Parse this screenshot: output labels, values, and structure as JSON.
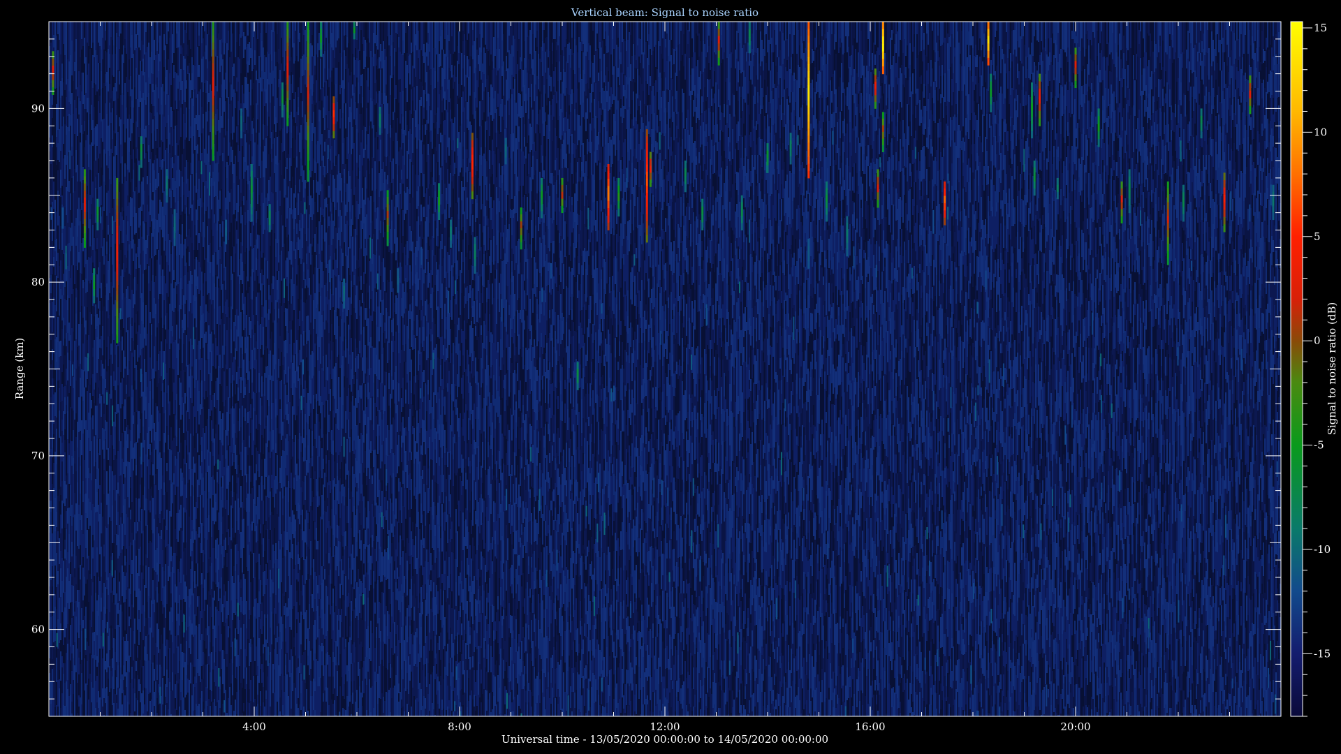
{
  "chart_data": {
    "type": "heatmap",
    "title": "Vertical beam: Signal to noise ratio",
    "xlabel": "Universal time - 13/05/2020 00:00:00 to 14/05/2020 00:00:00",
    "ylabel": "Range (km)",
    "colorbar_label": "Signal to noise ratio (dB)",
    "xlim": [
      0,
      24
    ],
    "ylim": [
      55,
      95
    ],
    "clim": [
      -18,
      15.3
    ],
    "x_ticks": [
      {
        "value": 4,
        "label": "4:00"
      },
      {
        "value": 8,
        "label": "8:00"
      },
      {
        "value": 12,
        "label": "12:00"
      },
      {
        "value": 16,
        "label": "16:00"
      },
      {
        "value": 20,
        "label": "20:00"
      }
    ],
    "y_ticks": [
      {
        "value": 60,
        "label": "60"
      },
      {
        "value": 70,
        "label": "70"
      },
      {
        "value": 80,
        "label": "80"
      },
      {
        "value": 90,
        "label": "90"
      }
    ],
    "colorbar_ticks": [
      {
        "value": 15,
        "label": "15"
      },
      {
        "value": 10,
        "label": "10"
      },
      {
        "value": 5,
        "label": "5"
      },
      {
        "value": 0,
        "label": "0"
      },
      {
        "value": -5,
        "label": "-5"
      },
      {
        "value": -10,
        "label": "-10"
      },
      {
        "value": -15,
        "label": "-15"
      }
    ],
    "colormap": [
      {
        "value": -18,
        "color": "#0a0a3a"
      },
      {
        "value": -15,
        "color": "#141c6e"
      },
      {
        "value": -12,
        "color": "#124a8c"
      },
      {
        "value": -9,
        "color": "#0a7a6a"
      },
      {
        "value": -5,
        "color": "#0a9a1c"
      },
      {
        "value": -2,
        "color": "#4a8a10"
      },
      {
        "value": 0,
        "color": "#8a4a08"
      },
      {
        "value": 2,
        "color": "#d82008"
      },
      {
        "value": 5,
        "color": "#ff2000"
      },
      {
        "value": 8,
        "color": "#ff7000"
      },
      {
        "value": 11,
        "color": "#ffb800"
      },
      {
        "value": 15.3,
        "color": "#ffff00"
      }
    ],
    "background_snr": -16,
    "echoes": [
      {
        "t": 0.08,
        "r0": 90.8,
        "r1": 93.3,
        "snr": 3
      },
      {
        "t": 0.27,
        "r0": 83.1,
        "r1": 84.3,
        "snr": -12
      },
      {
        "t": 0.7,
        "r0": 82.0,
        "r1": 86.5,
        "snr": 3
      },
      {
        "t": 0.88,
        "r0": 78.8,
        "r1": 80.8,
        "snr": -5
      },
      {
        "t": 0.95,
        "r0": 83.0,
        "r1": 84.8,
        "snr": -5
      },
      {
        "t": 1.33,
        "r0": 76.5,
        "r1": 86.0,
        "snr": 4
      },
      {
        "t": 1.8,
        "r0": 86.6,
        "r1": 88.4,
        "snr": -6
      },
      {
        "t": 2.3,
        "r0": 84.6,
        "r1": 86.5,
        "snr": -9
      },
      {
        "t": 2.45,
        "r0": 82.1,
        "r1": 84.2,
        "snr": -10
      },
      {
        "t": 3.2,
        "r0": 87.0,
        "r1": 95.0,
        "snr": 3
      },
      {
        "t": 3.45,
        "r0": 82.2,
        "r1": 83.6,
        "snr": -11
      },
      {
        "t": 3.75,
        "r0": 88.3,
        "r1": 90.0,
        "snr": -10
      },
      {
        "t": 3.95,
        "r0": 83.5,
        "r1": 86.8,
        "snr": -6
      },
      {
        "t": 4.3,
        "r0": 82.9,
        "r1": 84.5,
        "snr": -7
      },
      {
        "t": 4.55,
        "r0": 89.5,
        "r1": 91.5,
        "snr": -6
      },
      {
        "t": 4.65,
        "r0": 89.0,
        "r1": 95.0,
        "snr": 3
      },
      {
        "t": 5.05,
        "r0": 85.8,
        "r1": 95.0,
        "snr": 2
      },
      {
        "t": 5.3,
        "r0": 93.0,
        "r1": 95.0,
        "snr": -5
      },
      {
        "t": 5.55,
        "r0": 88.3,
        "r1": 90.7,
        "snr": 6
      },
      {
        "t": 5.75,
        "r0": 78.5,
        "r1": 80.2,
        "snr": -10
      },
      {
        "t": 5.95,
        "r0": 94.0,
        "r1": 95.0,
        "snr": -5
      },
      {
        "t": 6.45,
        "r0": 88.5,
        "r1": 90.1,
        "snr": -8
      },
      {
        "t": 6.6,
        "r0": 82.1,
        "r1": 85.3,
        "snr": 1
      },
      {
        "t": 6.8,
        "r0": 79.4,
        "r1": 80.8,
        "snr": -11
      },
      {
        "t": 7.6,
        "r0": 83.6,
        "r1": 85.7,
        "snr": -4
      },
      {
        "t": 7.83,
        "r0": 82.0,
        "r1": 83.6,
        "snr": -9
      },
      {
        "t": 8.25,
        "r0": 84.8,
        "r1": 88.6,
        "snr": 6
      },
      {
        "t": 8.3,
        "r0": 80.5,
        "r1": 82.6,
        "snr": -8
      },
      {
        "t": 8.9,
        "r0": 86.8,
        "r1": 88.3,
        "snr": -10
      },
      {
        "t": 9.2,
        "r0": 81.9,
        "r1": 84.3,
        "snr": 1
      },
      {
        "t": 9.6,
        "r0": 83.7,
        "r1": 86.0,
        "snr": -5
      },
      {
        "t": 10.0,
        "r0": 84.0,
        "r1": 86.0,
        "snr": 2
      },
      {
        "t": 10.3,
        "r0": 73.8,
        "r1": 75.4,
        "snr": -6
      },
      {
        "t": 10.9,
        "r0": 83.0,
        "r1": 86.8,
        "snr": 9
      },
      {
        "t": 11.1,
        "r0": 83.8,
        "r1": 86.0,
        "snr": -3
      },
      {
        "t": 11.65,
        "r0": 82.3,
        "r1": 88.8,
        "snr": 7
      },
      {
        "t": 11.72,
        "r0": 85.5,
        "r1": 87.5,
        "snr": 4
      },
      {
        "t": 12.4,
        "r0": 85.2,
        "r1": 87.0,
        "snr": -7
      },
      {
        "t": 12.73,
        "r0": 83.0,
        "r1": 84.8,
        "snr": -6
      },
      {
        "t": 13.05,
        "r0": 92.5,
        "r1": 95.0,
        "snr": 3
      },
      {
        "t": 13.5,
        "r0": 83.0,
        "r1": 85.0,
        "snr": -7
      },
      {
        "t": 13.65,
        "r0": 93.2,
        "r1": 95.0,
        "snr": -7
      },
      {
        "t": 14.0,
        "r0": 86.3,
        "r1": 88.0,
        "snr": -5
      },
      {
        "t": 14.45,
        "r0": 86.8,
        "r1": 88.6,
        "snr": -8
      },
      {
        "t": 14.8,
        "r0": 86.0,
        "r1": 95.0,
        "snr": 14
      },
      {
        "t": 14.8,
        "r0": 80.8,
        "r1": 82.5,
        "snr": -11
      },
      {
        "t": 15.15,
        "r0": 83.5,
        "r1": 85.8,
        "snr": -6
      },
      {
        "t": 15.55,
        "r0": 81.5,
        "r1": 83.8,
        "snr": -9
      },
      {
        "t": 16.1,
        "r0": 90.0,
        "r1": 92.3,
        "snr": 4
      },
      {
        "t": 16.15,
        "r0": 84.3,
        "r1": 86.5,
        "snr": 3
      },
      {
        "t": 16.25,
        "r0": 87.5,
        "r1": 89.8,
        "snr": 1
      },
      {
        "t": 16.25,
        "r0": 92.0,
        "r1": 95.0,
        "snr": 15
      },
      {
        "t": 17.45,
        "r0": 83.3,
        "r1": 85.8,
        "snr": 8
      },
      {
        "t": 18.3,
        "r0": 92.5,
        "r1": 95.0,
        "snr": 14
      },
      {
        "t": 18.35,
        "r0": 89.8,
        "r1": 92.0,
        "snr": -5
      },
      {
        "t": 19.15,
        "r0": 88.3,
        "r1": 91.5,
        "snr": -5
      },
      {
        "t": 19.2,
        "r0": 85.0,
        "r1": 87.0,
        "snr": -6
      },
      {
        "t": 19.3,
        "r0": 89.0,
        "r1": 92.0,
        "snr": 4
      },
      {
        "t": 19.65,
        "r0": 84.8,
        "r1": 86.0,
        "snr": -8
      },
      {
        "t": 20.0,
        "r0": 91.2,
        "r1": 93.5,
        "snr": 3
      },
      {
        "t": 20.45,
        "r0": 87.8,
        "r1": 90.0,
        "snr": -4
      },
      {
        "t": 20.9,
        "r0": 83.4,
        "r1": 85.8,
        "snr": 3
      },
      {
        "t": 21.05,
        "r0": 84.0,
        "r1": 86.5,
        "snr": -7
      },
      {
        "t": 21.8,
        "r0": 81.0,
        "r1": 85.8,
        "snr": 2
      },
      {
        "t": 22.1,
        "r0": 83.5,
        "r1": 85.6,
        "snr": -7
      },
      {
        "t": 22.45,
        "r0": 88.3,
        "r1": 90.0,
        "snr": -7
      },
      {
        "t": 22.9,
        "r0": 82.9,
        "r1": 86.3,
        "snr": 5
      },
      {
        "t": 23.4,
        "r0": 89.7,
        "r1": 91.9,
        "snr": 3
      },
      {
        "t": 23.85,
        "r0": 83.6,
        "r1": 85.6,
        "snr": -9
      }
    ]
  }
}
